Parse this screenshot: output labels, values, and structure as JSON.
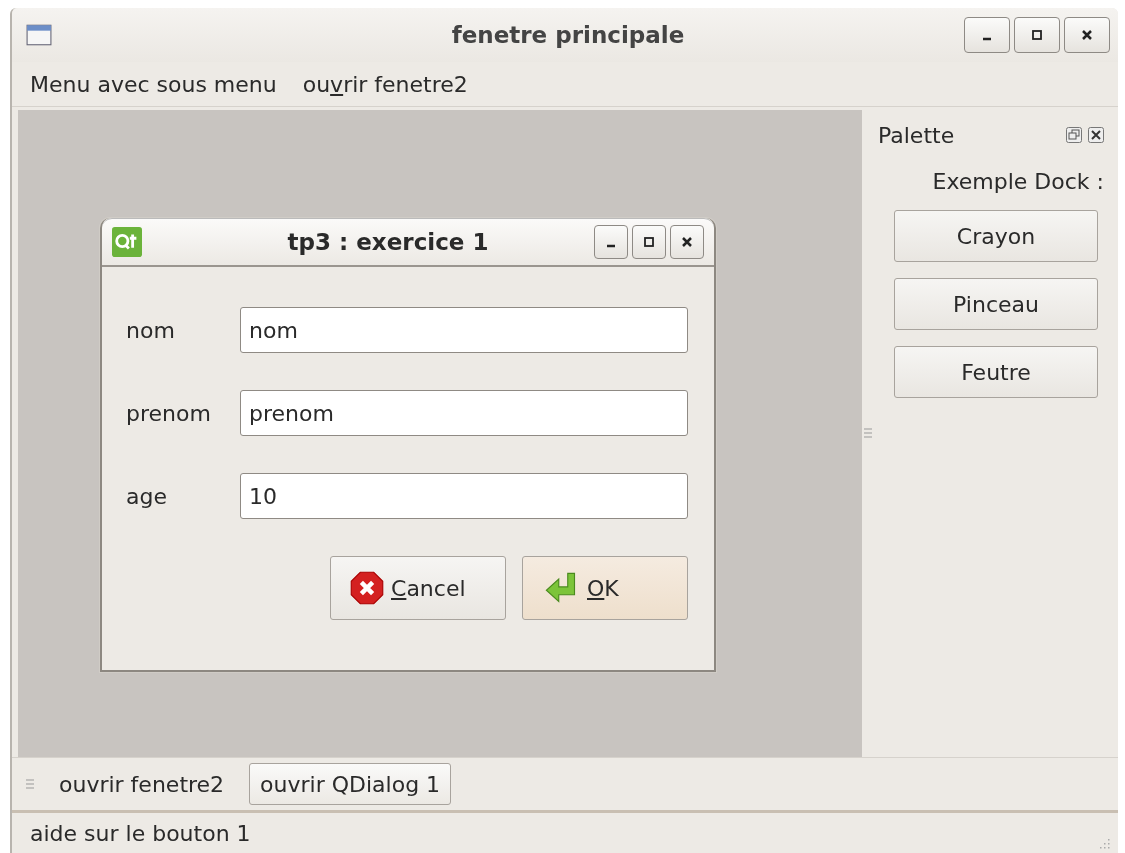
{
  "window": {
    "title": "fenetre principale"
  },
  "menu_bar": [
    {
      "label": {
        "before": "Menu avec sous menu"
      }
    },
    {
      "label": {
        "before": "ou",
        "key": "v",
        "after": "rir fenetre2"
      }
    }
  ],
  "dialog": {
    "title": "tp3 : exercice 1",
    "fields": [
      {
        "label": "nom",
        "value": "nom"
      },
      {
        "label": "prenom",
        "value": "prenom"
      },
      {
        "label": "age",
        "value": "10"
      }
    ],
    "buttons": [
      {
        "label": {
          "key": "C",
          "after": "ancel"
        },
        "kind": "cancel",
        "default": false
      },
      {
        "label": {
          "key": "O",
          "after": "K"
        },
        "kind": "ok",
        "default": true
      }
    ]
  },
  "dock": {
    "title": "Palette",
    "heading": "Exemple Dock :",
    "buttons": [
      "Crayon",
      "Pinceau",
      "Feutre"
    ]
  },
  "toolbar": [
    {
      "label": "ouvrir fenetre2",
      "raised": false
    },
    {
      "label": "ouvrir QDialog 1",
      "raised": true
    }
  ],
  "status_bar": "aide sur le bouton 1"
}
